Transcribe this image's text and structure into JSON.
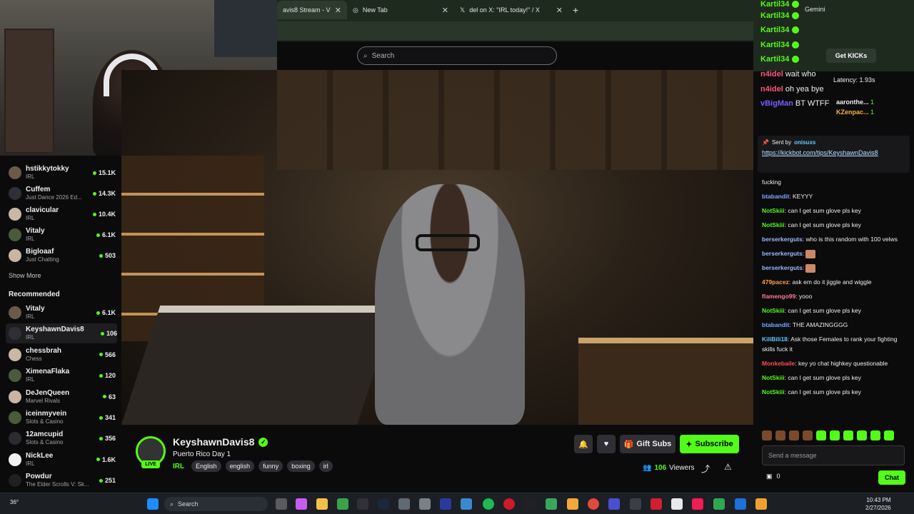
{
  "browser": {
    "tabs": [
      {
        "label": "avis8 Stream - V"
      },
      {
        "label": "New Tab"
      },
      {
        "label": "del on X: \"IRL today!\" / X"
      }
    ],
    "new_tab_symbol": "+"
  },
  "site": {
    "search_placeholder": "Search"
  },
  "sidebar": {
    "following": [
      {
        "name": "hstikkytokky",
        "category": "IRL",
        "viewers": "15.1K"
      },
      {
        "name": "Cuffem",
        "category": "Just Dance 2026 Ed...",
        "viewers": "14.3K"
      },
      {
        "name": "clavicular",
        "category": "IRL",
        "viewers": "10.4K"
      },
      {
        "name": "Vitaly",
        "category": "IRL",
        "viewers": "6.1K"
      },
      {
        "name": "Bigloaaf",
        "category": "Just Chatting",
        "viewers": "503"
      }
    ],
    "show_more": "Show More",
    "recommended_heading": "Recommended",
    "recommended": [
      {
        "name": "Vitaly",
        "category": "IRL",
        "viewers": "6.1K"
      },
      {
        "name": "KeyshawnDavis8",
        "category": "IRL",
        "viewers": "106"
      },
      {
        "name": "chessbrah",
        "category": "Chess",
        "viewers": "566"
      },
      {
        "name": "XimenaFlaka",
        "category": "IRL",
        "viewers": "120"
      },
      {
        "name": "DeJenQueen",
        "category": "Marvel Rivals",
        "viewers": "63"
      },
      {
        "name": "iceinmyvein",
        "category": "Slots & Casino",
        "viewers": "341"
      },
      {
        "name": "12amcupid",
        "category": "Slots & Casino",
        "viewers": "356"
      },
      {
        "name": "NickLee",
        "category": "IRL",
        "viewers": "1.6K"
      },
      {
        "name": "Powdur",
        "category": "The Elder Scrolls V: Sk...",
        "viewers": "251"
      }
    ]
  },
  "stream": {
    "streamer": "KeyshawnDavis8",
    "live_badge": "LIVE",
    "title": "Puerto Rico Day 1",
    "category": "IRL",
    "tags": [
      "English",
      "english",
      "funny",
      "boxing",
      "irl"
    ],
    "gift_label": "Gift Subs",
    "subscribe_label": "Subscribe",
    "viewer_count": "106",
    "viewers_label": "Viewers"
  },
  "chat": {
    "header_user": "Kartil34",
    "gemini_label": "Gemini",
    "get_kicks": "Get KICKs",
    "top_messages": [
      {
        "user": "n4idel",
        "text": "wait who"
      },
      {
        "user": "n4idel",
        "text": "oh yea bye"
      },
      {
        "user": "vBigMan",
        "text": "BT WTFF"
      }
    ],
    "latency": "Latency: 1.93s",
    "leaders": [
      {
        "name": "aaronthe...",
        "count": "1"
      },
      {
        "name": "KZenpac...",
        "count": "1"
      }
    ],
    "leader_badge_count": "5",
    "pinned": {
      "sent_by_label": "Sent by",
      "sender": "onisuxs",
      "link": "https://kickbot.com/tips/KeyshawnDavis8"
    },
    "messages": [
      {
        "user": "",
        "text": "fucking",
        "color": "#efeff1"
      },
      {
        "user": "btabandit",
        "text": "KEYYY",
        "color": "#7aa9ff"
      },
      {
        "user": "NotSkiii",
        "text": "can I get sum glove pls key",
        "color": "#53fc18"
      },
      {
        "user": "NotSkiii",
        "text": "can I get sum glove pls key",
        "color": "#53fc18"
      },
      {
        "user": "berserkerguts",
        "text": "who is this random with 100 velws",
        "color": "#9bb8ff"
      },
      {
        "user": "berserkerguts",
        "text": "",
        "color": "#9bb8ff"
      },
      {
        "user": "berserkerguts",
        "text": "",
        "color": "#9bb8ff"
      },
      {
        "user": "479pacez",
        "text": "ask em do it jiggle and wiggle",
        "color": "#ffa24a"
      },
      {
        "user": "flamengo99",
        "text": "yooo",
        "color": "#ff7a9a"
      },
      {
        "user": "NotSkiii",
        "text": "can I get sum glove pls key",
        "color": "#53fc18"
      },
      {
        "user": "btabandit",
        "text": "THE AMAZINGGGG",
        "color": "#7aa9ff"
      },
      {
        "user": "KiliBili18",
        "text": "Ask those Females to rank your fighting skills fuck it",
        "color": "#62c8ff"
      },
      {
        "user": "Monkebaile",
        "text": "key yo chat highkey questionable",
        "color": "#ff4d4d"
      },
      {
        "user": "NotSkiii",
        "text": "can I get sum glove pls key",
        "color": "#53fc18"
      },
      {
        "user": "NotSkiii",
        "text": "can I get sum glove pls key",
        "color": "#53fc18"
      }
    ],
    "input_placeholder": "Send a message",
    "balance": "0",
    "chat_button": "Chat"
  },
  "taskbar": {
    "temperature": "36°",
    "search_placeholder": "Search",
    "time": "10:43 PM",
    "date": "2/27/2026"
  },
  "colors": {
    "accent": "#53fc18",
    "background": "#0b0b0c"
  }
}
